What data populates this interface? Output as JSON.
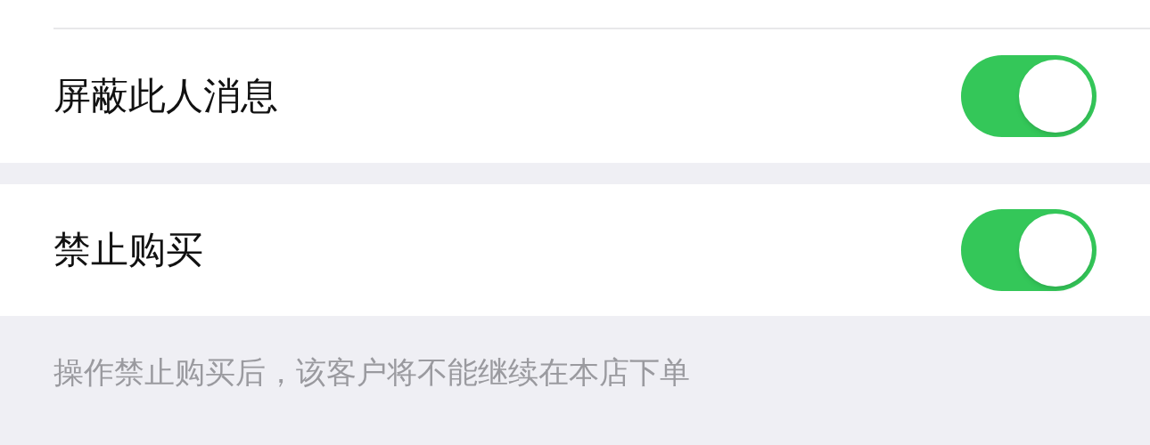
{
  "settings": [
    {
      "label": "屏蔽此人消息",
      "on": true
    },
    {
      "label": "禁止购买",
      "on": true
    }
  ],
  "footnote": "操作禁止购买后，该客户将不能继续在本店下单"
}
